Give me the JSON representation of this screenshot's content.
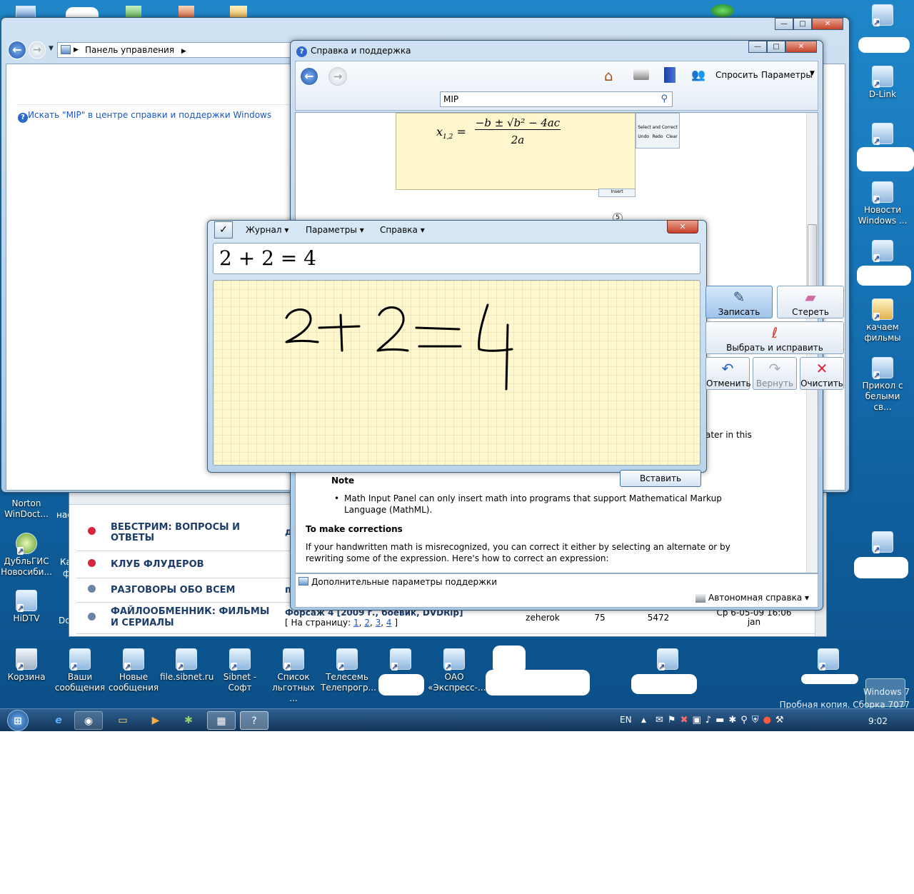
{
  "desktop": {
    "right_icons": [
      {
        "label": "D-Link"
      },
      {
        "label": "Новости Windows ..."
      },
      {
        "label": "качаем фильмы"
      },
      {
        "label": "Прикол с белыми св..."
      }
    ],
    "left_icons": [
      {
        "label": "Norton WinDoct..."
      },
      {
        "label": "ДубльГИС Новосиби..."
      },
      {
        "label": "HiDTV"
      }
    ],
    "partial_left": [
      {
        "label": "нас"
      },
      {
        "label": "Ка"
      },
      {
        "label": "ф"
      },
      {
        "label": "Dc"
      }
    ],
    "bottom_icons": [
      {
        "label": "Корзина"
      },
      {
        "label": "Ваши сообщения"
      },
      {
        "label": "Новые сообщения"
      },
      {
        "label": "file.sibnet.ru"
      },
      {
        "label": "Sibnet - Софт"
      },
      {
        "label": "Список льготных ..."
      },
      {
        "label": "Телесемь Телепрогр..."
      },
      {
        "label": "ОАО «Экспресс-..."
      }
    ],
    "watermark": {
      "line1": "Windows 7",
      "line2": "Пробная копия. Сборка 7077"
    }
  },
  "control_panel": {
    "breadcrumb": "Панель управления",
    "search_link": "Искать \"MIP\" в центре справки и поддержки Windows"
  },
  "help": {
    "title": "Справка и поддержка",
    "ask": "Спросить",
    "options": "Параметры",
    "search_value": "MIP",
    "formula_x": "x",
    "formula_sub": "1,2",
    "formula_num": "−b ± √b² − 4ac",
    "formula_den": "2a",
    "mini_select": "Select and Correct",
    "mini_undo": "Undo",
    "mini_redo": "Redo",
    "mini_clear": "Clear",
    "mini_insert": "Insert",
    "step_number": "5",
    "text_fragment": "ater in this",
    "note_title": "Note",
    "note_item": "Math Input Panel can only insert math into programs that support Mathematical Markup Language (MathML).",
    "corrections_title": "To make corrections",
    "corrections_text": "If your handwritten math is misrecognized, you can correct it either by selecting an alternate or by rewriting some of the expression. Here's how to correct an expression:",
    "more_support": "Дополнительные параметры поддержки",
    "offline": "Автономная справка"
  },
  "forum": {
    "rows": [
      {
        "title": "ВЕБСТРИМ: ВОПРОСЫ И ОТВЕТЫ",
        "mark": "д",
        "color": "#d9243a"
      },
      {
        "title": "КЛУБ ФЛУДЕРОВ",
        "mark": "",
        "color": "#d9243a"
      },
      {
        "title": "РАЗГОВОРЫ ОБО ВСЕМ",
        "mark": "п",
        "color": "#6c82a6"
      },
      {
        "title": "ФАЙЛООБМЕННИК: ФИЛЬМЫ И СЕРИАЛЫ",
        "mark": "",
        "color": "#6c82a6"
      }
    ],
    "last_topic": "Форсаж 4 [2009 г., боевик, DVDRip]",
    "pages_label": "[ На страницу:",
    "pages": [
      "1",
      "2",
      "3",
      "4"
    ],
    "pages_end": "]",
    "author": "zeherok",
    "replies": "75",
    "views": "5472",
    "last_date": "Ср 6-05-09 16:06",
    "last_user": "jan"
  },
  "math_panel": {
    "menu": [
      "Журнал",
      "Параметры",
      "Справка"
    ],
    "preview": "2 + 2 = 4",
    "buttons": {
      "write": "Записать",
      "erase": "Стереть",
      "select": "Выбрать и исправить",
      "undo": "Отменить",
      "redo": "Вернуть",
      "clear": "Очистить"
    },
    "insert": "Вставить"
  },
  "taskbar": {
    "lang": "EN",
    "time": "9:02"
  },
  "colors": {
    "accent": "#1c57c7",
    "ink": "#000000",
    "writing_pad": "#fff7cd",
    "danger": "#d9243a"
  }
}
